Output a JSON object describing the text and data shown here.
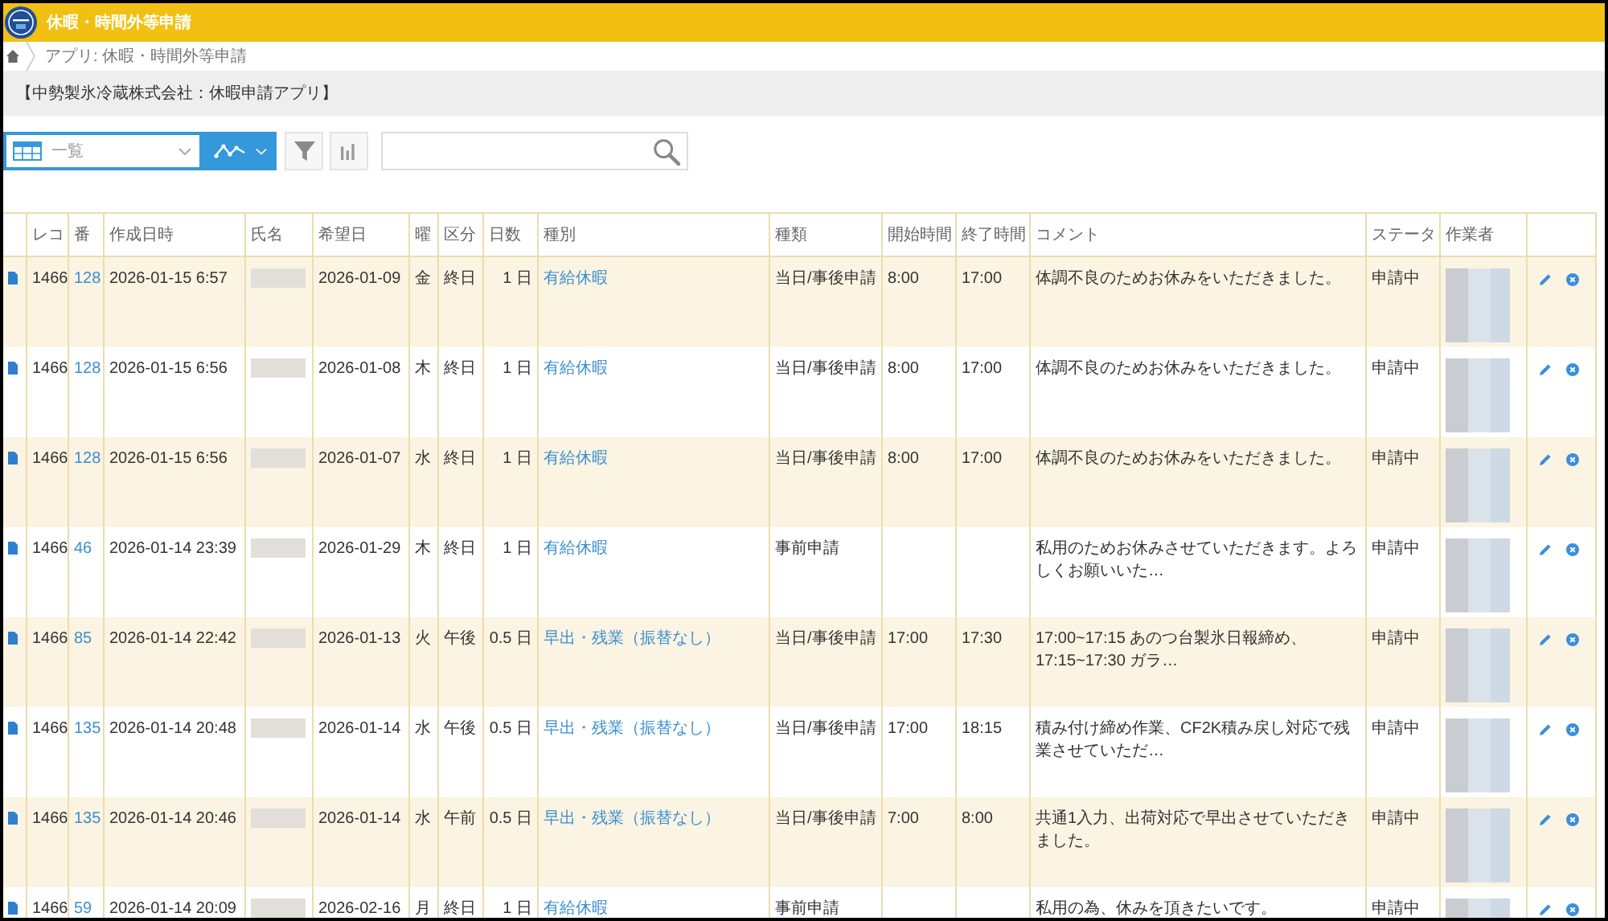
{
  "header": {
    "title": "休暇・時間外等申請"
  },
  "breadcrumb": [
    {
      "label": "アプリ: 休暇・時間外等申請"
    }
  ],
  "banner": {
    "text": "【中勢製氷冷蔵株式会社：休暇申請アプリ】"
  },
  "toolbar": {
    "view": "一覧"
  },
  "table": {
    "columns": [
      {
        "label": "レコ"
      },
      {
        "label": "番"
      },
      {
        "label": "作成日時"
      },
      {
        "label": "氏名"
      },
      {
        "label": "希望日"
      },
      {
        "label": "曜"
      },
      {
        "label": "区分"
      },
      {
        "label": "日数"
      },
      {
        "label": "種別"
      },
      {
        "label": "種類"
      },
      {
        "label": "開始時間"
      },
      {
        "label": "終了時間"
      },
      {
        "label": "コメント"
      },
      {
        "label": "ステータ"
      },
      {
        "label": "作業者"
      }
    ],
    "rows": [
      {
        "record_no": "1466",
        "number": "128",
        "created_at": "2026-01-15 6:57",
        "requested_date": "2026-01-09",
        "weekday": "金",
        "period": "終日",
        "days": "1 日",
        "leave_type": "有給休暇",
        "request_type": "当日/事後申請",
        "start_time": "8:00",
        "end_time": "17:00",
        "comment": "体調不良のためお休みをいただきました。",
        "status": "申請中"
      },
      {
        "record_no": "1466",
        "number": "128",
        "created_at": "2026-01-15 6:56",
        "requested_date": "2026-01-08",
        "weekday": "木",
        "period": "終日",
        "days": "1 日",
        "leave_type": "有給休暇",
        "request_type": "当日/事後申請",
        "start_time": "8:00",
        "end_time": "17:00",
        "comment": "体調不良のためお休みをいただきました。",
        "status": "申請中"
      },
      {
        "record_no": "1466",
        "number": "128",
        "created_at": "2026-01-15 6:56",
        "requested_date": "2026-01-07",
        "weekday": "水",
        "period": "終日",
        "days": "1 日",
        "leave_type": "有給休暇",
        "request_type": "当日/事後申請",
        "start_time": "8:00",
        "end_time": "17:00",
        "comment": "体調不良のためお休みをいただきました。",
        "status": "申請中"
      },
      {
        "record_no": "1466",
        "number": "46",
        "created_at": "2026-01-14 23:39",
        "requested_date": "2026-01-29",
        "weekday": "木",
        "period": "終日",
        "days": "1 日",
        "leave_type": "有給休暇",
        "request_type": "事前申請",
        "comment": "私用のためお休みさせていただきます。よろしくお願いいた…",
        "status": "申請中"
      },
      {
        "record_no": "1466",
        "number": "85",
        "created_at": "2026-01-14 22:42",
        "requested_date": "2026-01-13",
        "weekday": "火",
        "period": "午後",
        "days": "0.5 日",
        "leave_type": "早出・残業（振替なし）",
        "request_type": "当日/事後申請",
        "start_time": "17:00",
        "end_time": "17:30",
        "comment": "17:00~17:15 あのつ台製氷日報締め、17:15~17:30 ガラ…",
        "status": "申請中"
      },
      {
        "record_no": "1466",
        "number": "135",
        "created_at": "2026-01-14 20:48",
        "requested_date": "2026-01-14",
        "weekday": "水",
        "period": "午後",
        "days": "0.5 日",
        "leave_type": "早出・残業（振替なし）",
        "request_type": "当日/事後申請",
        "start_time": "17:00",
        "end_time": "18:15",
        "comment": "積み付け締め作業、CF2K積み戻し対応で残業させていただ…",
        "status": "申請中"
      },
      {
        "record_no": "1466",
        "number": "135",
        "created_at": "2026-01-14 20:46",
        "requested_date": "2026-01-14",
        "weekday": "水",
        "period": "午前",
        "days": "0.5 日",
        "leave_type": "早出・残業（振替なし）",
        "request_type": "当日/事後申請",
        "start_time": "7:00",
        "end_time": "8:00",
        "comment": "共通1入力、出荷対応で早出させていただきました。",
        "status": "申請中"
      },
      {
        "record_no": "1466",
        "number": "59",
        "created_at": "2026-01-14 20:09",
        "requested_date": "2026-02-16",
        "weekday": "月",
        "period": "終日",
        "days": "1 日",
        "leave_type": "有給休暇",
        "request_type": "事前申請",
        "comment": "私用の為、休みを頂きたいです。",
        "status": "申請中"
      }
    ]
  }
}
